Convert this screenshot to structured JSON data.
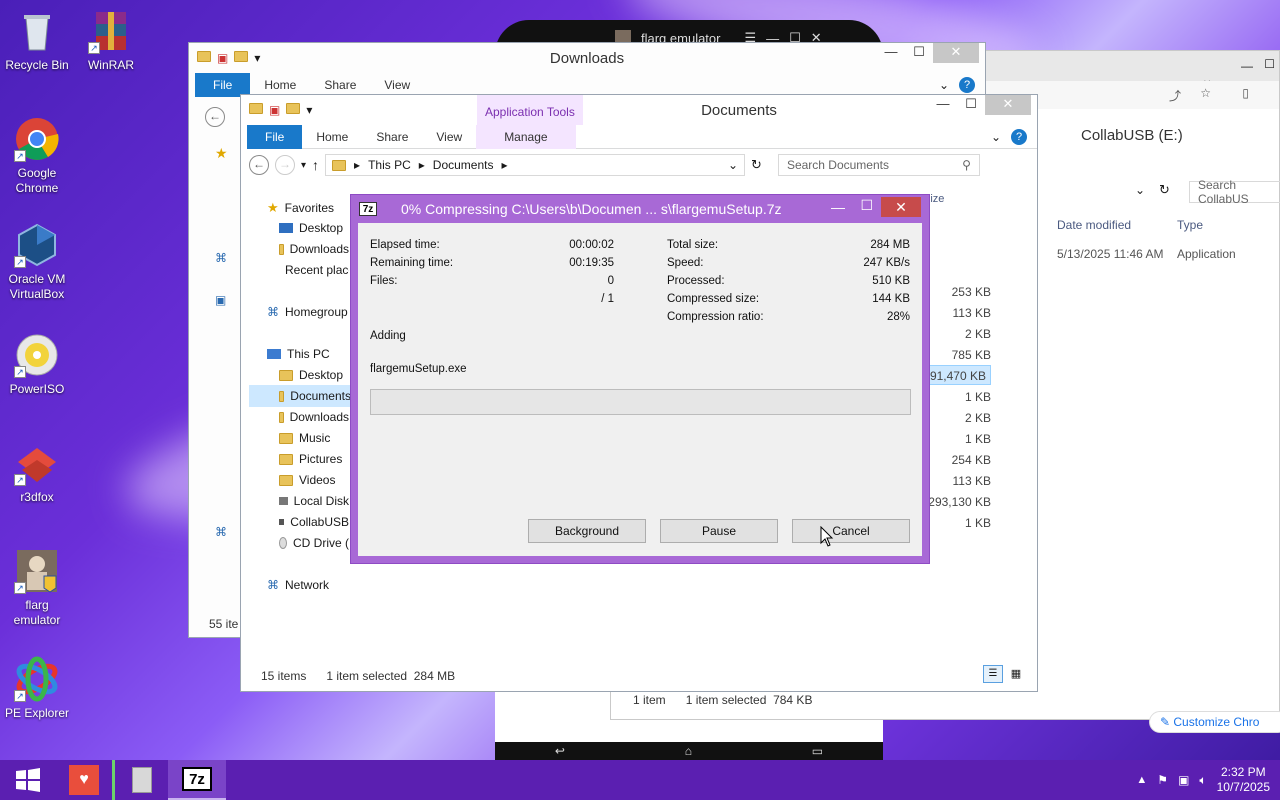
{
  "desktop": {
    "icons": [
      {
        "label": "Recycle Bin"
      },
      {
        "label": "WinRAR"
      },
      {
        "label": "Google Chrome"
      },
      {
        "label": "Oracle VM VirtualBox"
      },
      {
        "label": "PowerISO"
      },
      {
        "label": "r3dfox"
      },
      {
        "label": "flarg emulator"
      },
      {
        "label": "PE Explorer"
      }
    ]
  },
  "emulator_window": {
    "title": "flarg emulator"
  },
  "downloads_window": {
    "title": "Downloads",
    "tabs": [
      "File",
      "Home",
      "Share",
      "View"
    ],
    "status": "55 ite"
  },
  "collab_window": {
    "title": "CollabUSB (E:)",
    "search_placeholder": "Search CollabUS",
    "col_date": "Date modified",
    "col_type": "Type",
    "row_date": "5/13/2025 11:46 AM",
    "row_type": "Application",
    "status_items": "1 item",
    "status_selected": "1 item selected",
    "status_size": "784 KB",
    "customize": "Customize Chro"
  },
  "documents_window": {
    "title": "Documents",
    "context_tab": "Application Tools",
    "tabs": [
      "File",
      "Home",
      "Share",
      "View",
      "Manage"
    ],
    "breadcrumb": [
      "This PC",
      "Documents"
    ],
    "search_placeholder": "Search Documents",
    "col_size": "Size",
    "nav": {
      "favorites": "Favorites",
      "desktop": "Desktop",
      "downloads": "Downloads",
      "recent": "Recent places",
      "homegroup": "Homegroup",
      "this_pc": "This PC",
      "pc_desktop": "Desktop",
      "pc_documents": "Documents",
      "pc_downloads": "Downloads",
      "music": "Music",
      "pictures": "Pictures",
      "videos": "Videos",
      "local_disk": "Local Disk",
      "collabusb": "CollabUSB",
      "cd_drive": "CD Drive (",
      "network": "Network"
    },
    "sizes": [
      "253 KB",
      "113 KB",
      "2 KB",
      "785 KB",
      "291,470 KB",
      "1 KB",
      "2 KB",
      "1 KB",
      "254 KB",
      "113 KB",
      "293,130 KB",
      "1 KB"
    ],
    "status_items": "15 items",
    "status_selected": "1 item selected",
    "status_size": "284 MB"
  },
  "zip_dialog": {
    "badge": "7z",
    "title": "0% Compressing C:\\Users\\b\\Documen ... s\\flargemuSetup.7z",
    "elapsed_label": "Elapsed time:",
    "elapsed_value": "00:00:02",
    "remaining_label": "Remaining time:",
    "remaining_value": "00:19:35",
    "files_label": "Files:",
    "files_value": "0",
    "files_total": "/ 1",
    "total_label": "Total size:",
    "total_value": "284 MB",
    "speed_label": "Speed:",
    "speed_value": "247 KB/s",
    "processed_label": "Processed:",
    "processed_value": "510 KB",
    "compressed_label": "Compressed size:",
    "compressed_value": "144 KB",
    "ratio_label": "Compression ratio:",
    "ratio_value": "28%",
    "action": "Adding",
    "current_file": "flargemuSetup.exe",
    "progress": 0,
    "btn_background": "Background",
    "btn_pause": "Pause",
    "btn_cancel": "Cancel"
  },
  "taskbar": {
    "time": "2:32 PM",
    "date": "10/7/2025",
    "active_badge": "7z"
  }
}
